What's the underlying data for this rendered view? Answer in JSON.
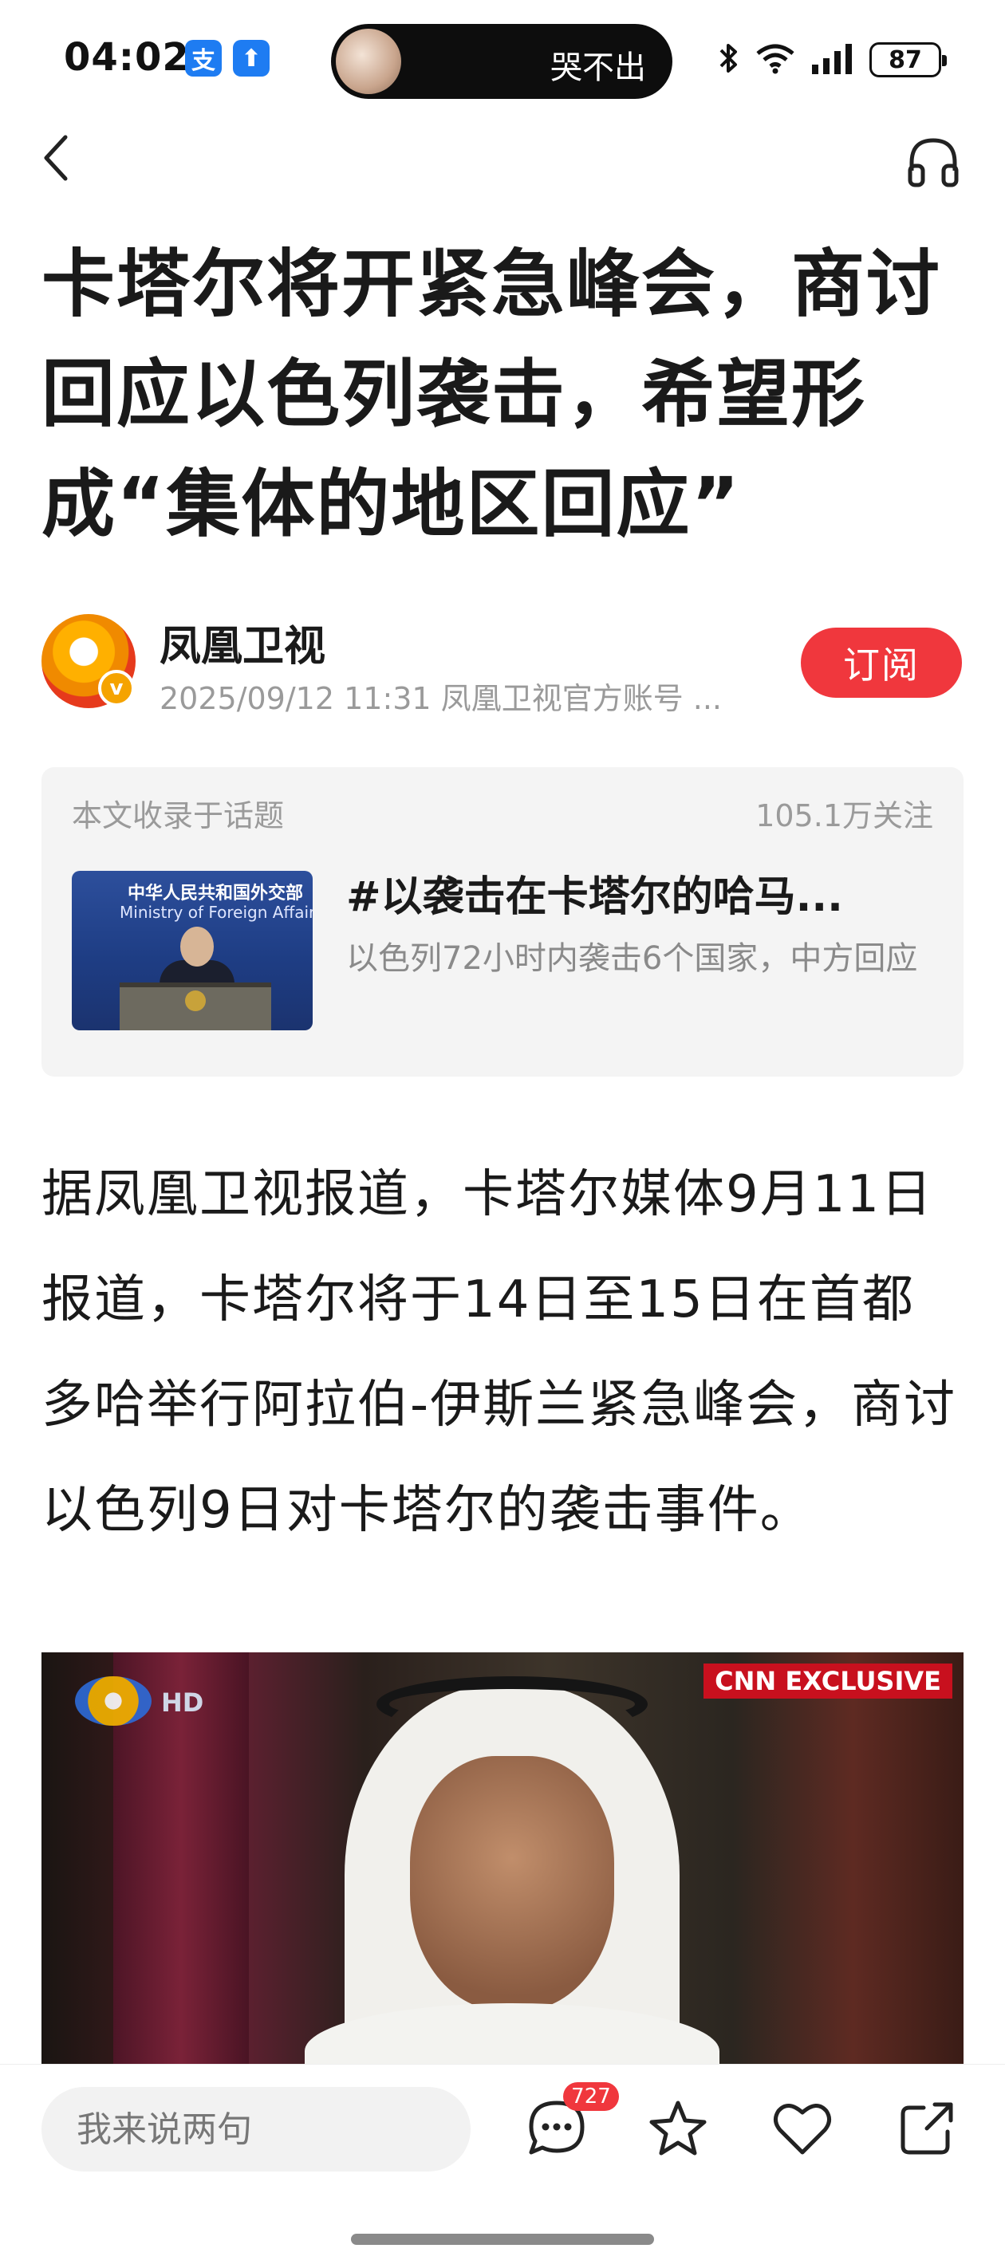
{
  "status_bar": {
    "time": "04:02",
    "app_icons": [
      "支",
      "⬆"
    ],
    "media_title": "哭不出",
    "battery": "87"
  },
  "article": {
    "title": "卡塔尔将开紧急峰会，商讨回应以色列袭击，希望形成“集体的地区回应”",
    "author": {
      "name": "凤凰卫视",
      "meta": "2025/09/12 11:31 凤凰卫视官方账号 ...",
      "verified_mark": "v",
      "subscribe_label": "订阅"
    },
    "topic": {
      "label": "本文收录于话题",
      "followers": "105.1万关注",
      "title": "#以袭击在卡塔尔的哈马...",
      "description": "以色列72小时内袭击6个国家，中方回应",
      "thumb_text_cn": "中华人民共和国外交部",
      "thumb_text_en": "Ministry of Foreign Affairs"
    },
    "body": "据凤凰卫视报道，卡塔尔媒体9月11日报道，卡塔尔将于14日至15日在首都多哈举行阿拉伯-伊斯兰紧急峰会，商讨以色列9日对卡塔尔的袭击事件。",
    "image": {
      "badge": "CNN EXCLUSIVE",
      "hd_label": "HD"
    }
  },
  "bottom_bar": {
    "comment_placeholder": "我来说两句",
    "comment_count": "727"
  },
  "colors": {
    "accent_red": "#f0373d",
    "title_text": "#1a1a1a",
    "muted_text": "#9a9a9a",
    "card_bg": "#f4f4f4"
  },
  "icons": [
    "back-arrow-icon",
    "headphones-icon",
    "comment-icon",
    "star-icon",
    "heart-icon",
    "share-icon",
    "bluetooth-icon",
    "wifi-icon",
    "signal-icon",
    "battery-icon"
  ]
}
